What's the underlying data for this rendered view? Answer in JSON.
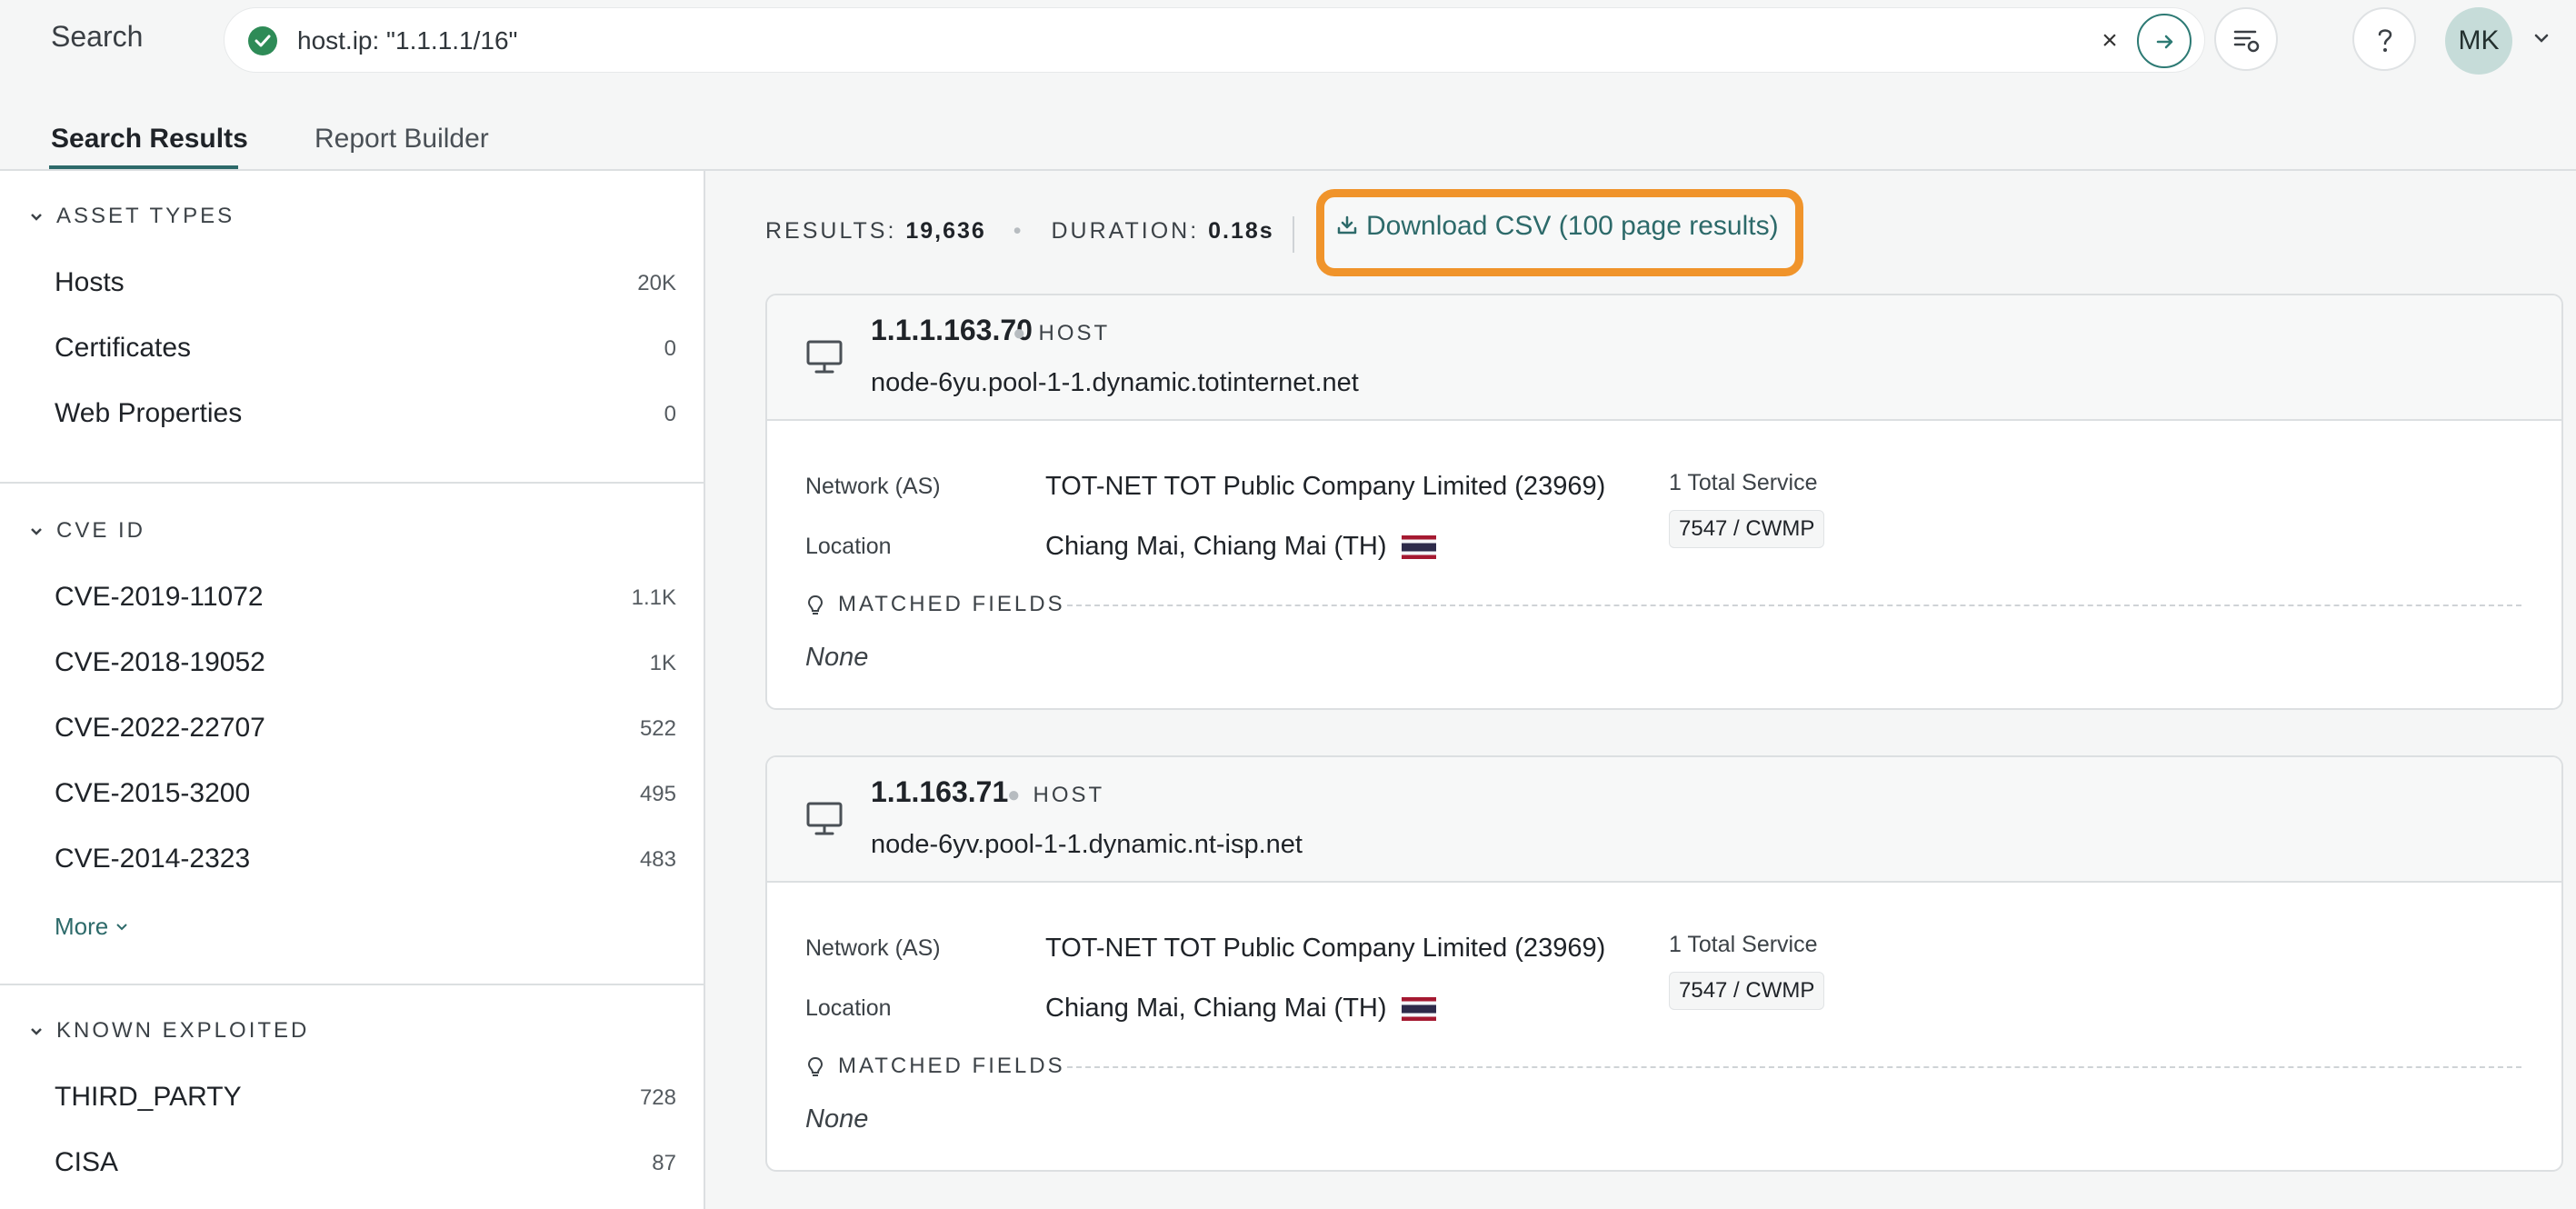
{
  "topbar": {
    "title": "Search",
    "query": "host.ip: \"1.1.1.1/16\"",
    "clear_icon": "close-icon",
    "go_icon": "arrow-right-icon",
    "filter_icon": "filter-settings-icon",
    "help_icon": "help-icon",
    "avatar_initials": "MK"
  },
  "tabs": [
    {
      "label": "Search Results",
      "active": true
    },
    {
      "label": "Report Builder",
      "active": false
    }
  ],
  "sidebar": {
    "asset_types": {
      "title": "ASSET TYPES",
      "items": [
        {
          "label": "Hosts",
          "count": "20K"
        },
        {
          "label": "Certificates",
          "count": "0"
        },
        {
          "label": "Web Properties",
          "count": "0"
        }
      ]
    },
    "cve": {
      "title": "CVE ID",
      "items": [
        {
          "label": "CVE-2019-11072",
          "count": "1.1K"
        },
        {
          "label": "CVE-2018-19052",
          "count": "1K"
        },
        {
          "label": "CVE-2022-22707",
          "count": "522"
        },
        {
          "label": "CVE-2015-3200",
          "count": "495"
        },
        {
          "label": "CVE-2014-2323",
          "count": "483"
        }
      ],
      "more_label": "More"
    },
    "known_exploited": {
      "title": "KNOWN EXPLOITED",
      "items": [
        {
          "label": "THIRD_PARTY",
          "count": "728"
        },
        {
          "label": "CISA",
          "count": "87"
        }
      ]
    }
  },
  "results": {
    "results_label": "RESULTS:",
    "results_value": "19,636",
    "duration_label": "DURATION:",
    "duration_value": "0.18s",
    "csv_label": "Download CSV (100 page results)",
    "accent": "#f0942b",
    "cards": [
      {
        "ip": "1.1.1.163.70",
        "type": "HOST",
        "hostname": "node-6yu.pool-1-1.dynamic.totinternet.net",
        "network_label": "Network (AS)",
        "network_value": "TOT-NET TOT Public Company Limited (23969)",
        "location_label": "Location",
        "location_value": "Chiang Mai, Chiang Mai (TH)",
        "services_total": "1 Total Service",
        "service_chip": "7547 / CWMP",
        "matched_label": "MATCHED FIELDS",
        "matched_value": "None"
      },
      {
        "ip": "1.1.163.71",
        "type": "HOST",
        "hostname": "node-6yv.pool-1-1.dynamic.nt-isp.net",
        "network_label": "Network (AS)",
        "network_value": "TOT-NET TOT Public Company Limited (23969)",
        "location_label": "Location",
        "location_value": "Chiang Mai, Chiang Mai (TH)",
        "services_total": "1 Total Service",
        "service_chip": "7547 / CWMP",
        "matched_label": "MATCHED FIELDS",
        "matched_value": "None"
      }
    ]
  }
}
